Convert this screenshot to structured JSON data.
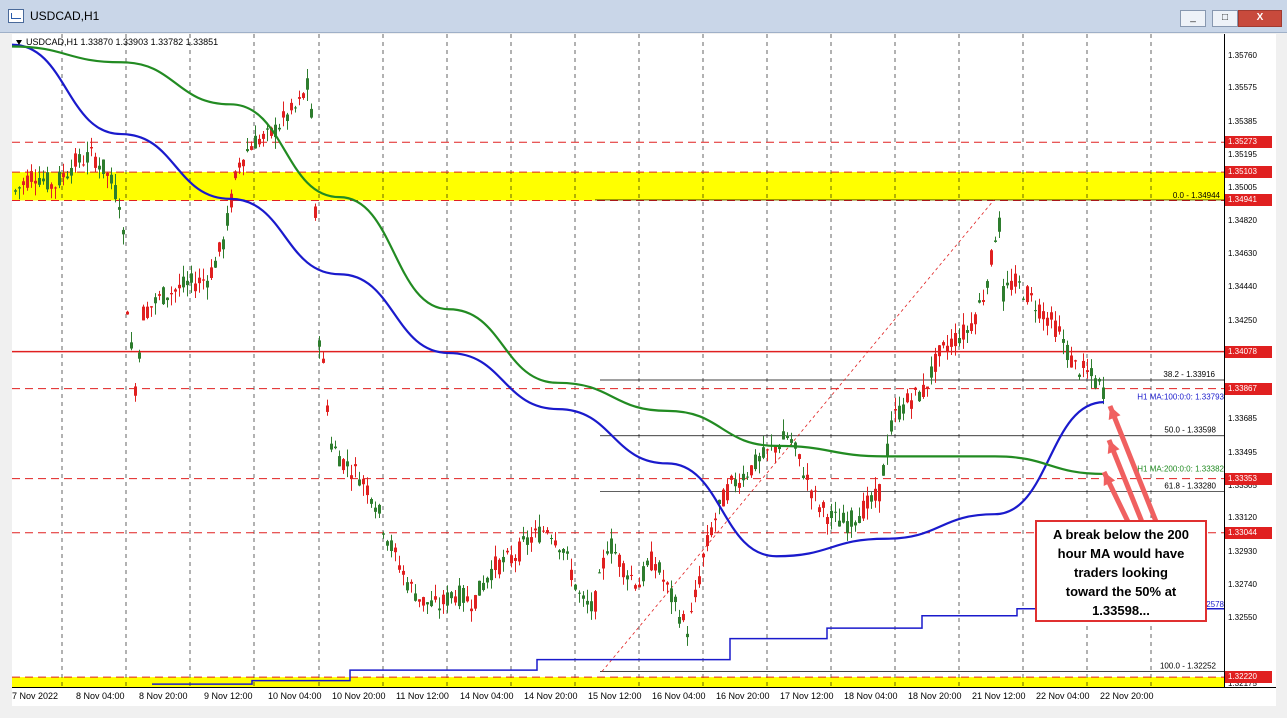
{
  "window": {
    "title": "USDCAD,H1",
    "buttons": [
      "_",
      "□",
      "X"
    ]
  },
  "header": {
    "symbol_line": "USDCAD,H1  1.33870 1.33903 1.33782 1.33851"
  },
  "price_axis": {
    "labels": [
      {
        "text": "1.35760",
        "price": 1.3576
      },
      {
        "text": "1.35575",
        "price": 1.35575
      },
      {
        "text": "1.35385",
        "price": 1.35385
      },
      {
        "text": "1.35195",
        "price": 1.35195
      },
      {
        "text": "1.35005",
        "price": 1.35005
      },
      {
        "text": "1.34820",
        "price": 1.3482
      },
      {
        "text": "1.34630",
        "price": 1.3463
      },
      {
        "text": "1.34440",
        "price": 1.3444
      },
      {
        "text": "1.34250",
        "price": 1.3425
      },
      {
        "text": "1.33685",
        "price": 1.33685
      },
      {
        "text": "1.33495",
        "price": 1.33495
      },
      {
        "text": "1.33305",
        "price": 1.33305
      },
      {
        "text": "1.33120",
        "price": 1.3312
      },
      {
        "text": "1.32930",
        "price": 1.3293
      },
      {
        "text": "1.32740",
        "price": 1.3274
      },
      {
        "text": "1.32550",
        "price": 1.3255
      },
      {
        "text": "1.32175",
        "price": 1.32175
      }
    ],
    "tags": [
      {
        "text": "1.35273",
        "price": 1.35273,
        "kind": "red"
      },
      {
        "text": "1.35103",
        "price": 1.35103,
        "kind": "red"
      },
      {
        "text": "1.34941",
        "price": 1.34941,
        "kind": "red"
      },
      {
        "text": "1.34078",
        "price": 1.34078,
        "kind": "red"
      },
      {
        "text": "1.33867",
        "price": 1.33867,
        "kind": "red"
      },
      {
        "text": "1.33353",
        "price": 1.33353,
        "kind": "red"
      },
      {
        "text": "1.33044",
        "price": 1.33044,
        "kind": "red"
      },
      {
        "text": "1.32220",
        "price": 1.3222,
        "kind": "red"
      }
    ]
  },
  "time_axis": {
    "labels": [
      "7 Nov 2022",
      "8 Nov 04:00",
      "8 Nov 20:00",
      "9 Nov 12:00",
      "10 Nov 04:00",
      "10 Nov 20:00",
      "11 Nov 12:00",
      "14 Nov 04:00",
      "14 Nov 20:00",
      "15 Nov 12:00",
      "16 Nov 04:00",
      "16 Nov 20:00",
      "17 Nov 12:00",
      "18 Nov 04:00",
      "18 Nov 20:00",
      "21 Nov 12:00",
      "22 Nov 04:00",
      "22 Nov 20:00"
    ]
  },
  "levels": {
    "fib_0": {
      "text": "0.0 - 1.34944",
      "price": 1.34944
    },
    "fib_382": {
      "text": "38.2 - 1.33916",
      "price": 1.33916
    },
    "fib_50": {
      "text": "50.0 - 1.33598",
      "price": 1.33598
    },
    "fib_618": {
      "text": "61.8 - 1.33280",
      "price": 1.3328
    },
    "fib_100": {
      "text": "100.0 - 1.32252",
      "price": 1.32252
    },
    "ma100": {
      "text": "H1 MA:100:0:0: 1.33793",
      "price": 1.33793
    },
    "ma200": {
      "text": "H1 MA:200:0:0: 1.33382",
      "price": 1.33382
    },
    "other_blue": {
      "text": "2578"
    }
  },
  "annotation": {
    "lines": [
      "A break below the 200",
      "hour MA would have",
      "traders looking",
      "toward the 50% at",
      "1.33598..."
    ]
  },
  "colors": {
    "candle_up": "#2e7d2e",
    "candle_down": "#e02020",
    "ma100": "#1a1acc",
    "ma200": "#228b22",
    "resistance_zone": "#ffff00",
    "hline": "#e02020",
    "callout_border": "#e03030"
  },
  "chart_data": {
    "type": "line",
    "ylim": [
      1.3214,
      1.3582
    ],
    "series": [
      {
        "name": "H1 MA:100:0:0",
        "x": [
          0,
          10,
          20,
          30,
          40,
          50,
          60,
          70,
          80,
          90,
          100
        ],
        "values": [
          1.3583,
          1.3532,
          1.3495,
          1.3452,
          1.3407,
          1.3375,
          1.3344,
          1.3291,
          1.3301,
          1.3315,
          1.3379
        ]
      },
      {
        "name": "H1 MA:200:0:0",
        "x": [
          0,
          10,
          20,
          30,
          40,
          50,
          60,
          70,
          80,
          90,
          100
        ],
        "values": [
          1.3582,
          1.3573,
          1.3549,
          1.3496,
          1.3432,
          1.339,
          1.3374,
          1.3354,
          1.3348,
          1.3348,
          1.3338
        ]
      }
    ]
  }
}
